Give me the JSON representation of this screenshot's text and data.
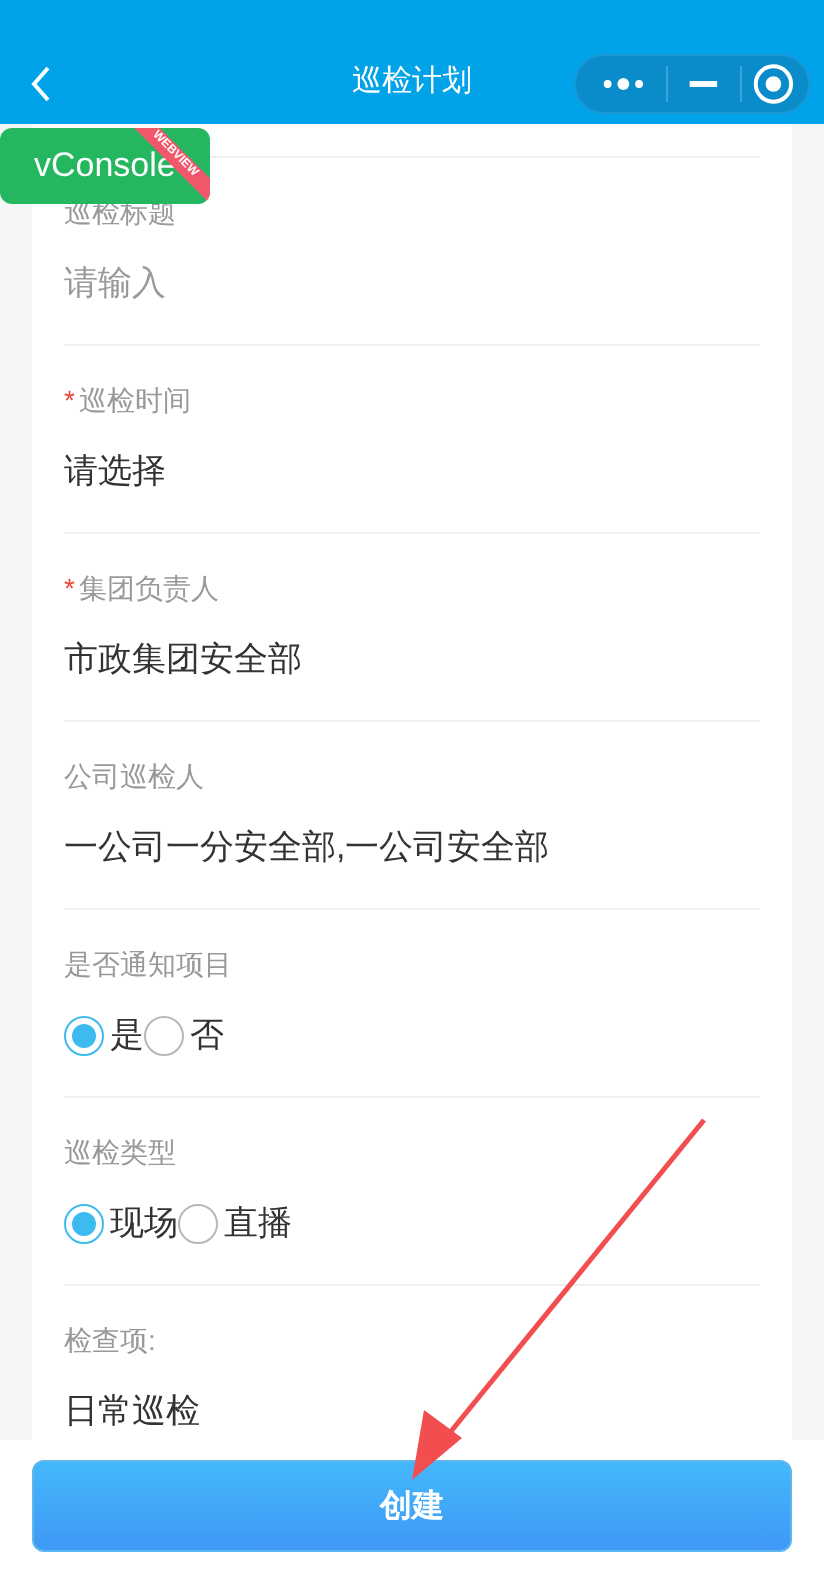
{
  "header": {
    "title": "巡检计划"
  },
  "fields": [
    {
      "kind": "input",
      "label": "巡检标题",
      "required": false,
      "placeholder": "请输入"
    },
    {
      "kind": "picker",
      "label": "巡检时间",
      "required": true,
      "placeholder": "请选择"
    },
    {
      "kind": "text",
      "label": "集团负责人",
      "required": true,
      "value": "市政集团安全部"
    },
    {
      "kind": "text",
      "label": "公司巡检人",
      "required": false,
      "value": "一公司一分安全部,一公司安全部"
    },
    {
      "kind": "radio",
      "label": "是否通知项目",
      "required": false,
      "options": [
        {
          "label": "是",
          "selected": true
        },
        {
          "label": "否",
          "selected": false
        }
      ]
    },
    {
      "kind": "radio",
      "label": "巡检类型",
      "required": false,
      "options": [
        {
          "label": "现场",
          "selected": true
        },
        {
          "label": "直播",
          "selected": false
        }
      ]
    },
    {
      "kind": "text",
      "label": "检查项:",
      "required": false,
      "value": "日常巡检"
    }
  ],
  "required_mark": "*",
  "submit_button": "创建",
  "vconsole": {
    "label": "vConsole",
    "ribbon": "WEBVIEW"
  },
  "annotation": {
    "kind": "arrow"
  }
}
